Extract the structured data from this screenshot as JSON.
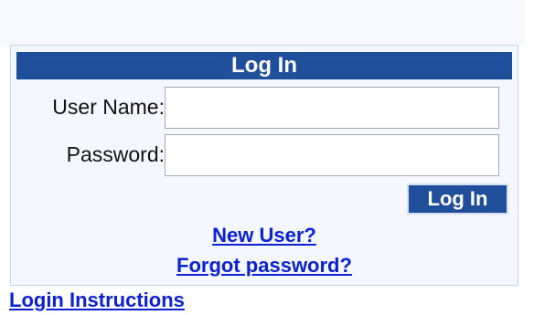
{
  "login": {
    "header_title": "Log In",
    "username_label": "User Name:",
    "username_value": "",
    "password_label": "Password:",
    "password_value": "",
    "submit_label": "Log In",
    "new_user_link": "New User?",
    "forgot_password_link": "Forgot password?"
  },
  "footer": {
    "instructions_link": "Login Instructions"
  },
  "colors": {
    "header_bg": "#1f4e9a",
    "link": "#0a22d4",
    "panel_bg": "#f4f7fd"
  }
}
